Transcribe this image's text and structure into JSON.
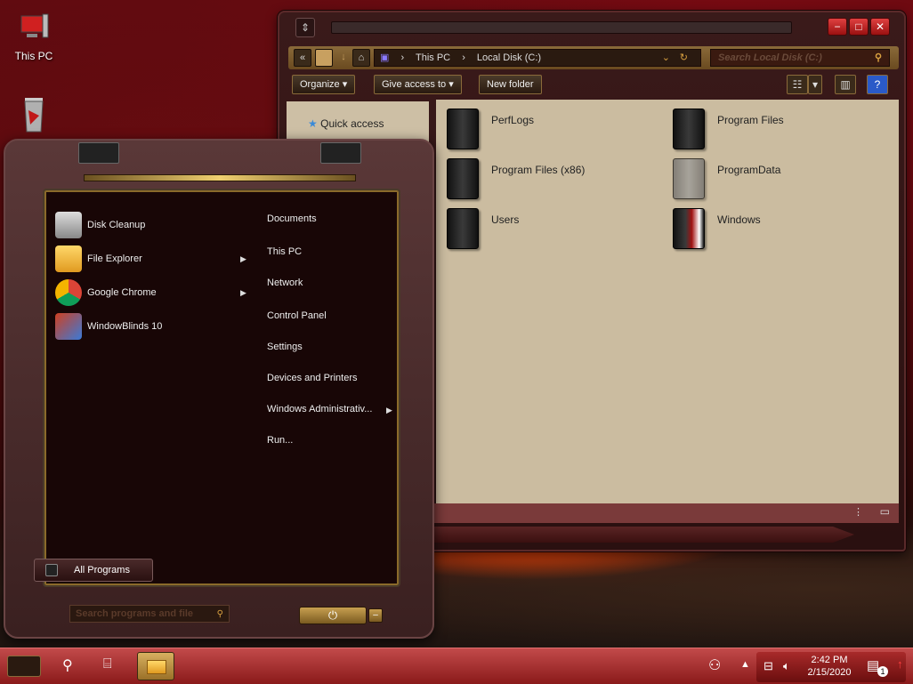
{
  "desktop": {
    "icons": [
      {
        "label": "This PC",
        "icon": "this-pc-icon"
      },
      {
        "label": "",
        "icon": "recycle-bin-icon"
      }
    ]
  },
  "explorer": {
    "title_menu_icon": "window-menu-icon",
    "controls": {
      "minimize": "−",
      "maximize": "□",
      "close": "✕"
    },
    "breadcrumb": [
      "This PC",
      "Local Disk (C:)"
    ],
    "search_placeholder": "Search Local Disk (C:)",
    "toolbar": {
      "organize": "Organize",
      "give_access": "Give access to",
      "new_folder": "New folder"
    },
    "nav_pane": {
      "quick_access": "Quick access"
    },
    "folders": [
      {
        "name": "PerfLogs"
      },
      {
        "name": "Program Files"
      },
      {
        "name": "Program Files (x86)"
      },
      {
        "name": "ProgramData"
      },
      {
        "name": "Users"
      },
      {
        "name": "Windows"
      }
    ]
  },
  "start_menu": {
    "programs": [
      {
        "label": "Disk Cleanup",
        "icon": "disk-cleanup-icon",
        "has_submenu": false
      },
      {
        "label": "File Explorer",
        "icon": "file-explorer-icon",
        "has_submenu": true
      },
      {
        "label": "Google Chrome",
        "icon": "chrome-icon",
        "has_submenu": true
      },
      {
        "label": "WindowBlinds 10",
        "icon": "windowblinds-icon",
        "has_submenu": false
      }
    ],
    "places": [
      "Documents",
      "This PC",
      "Network",
      "Control Panel",
      "Settings",
      "Devices and Printers",
      "Windows Administrativ...",
      "Run..."
    ],
    "all_programs": "All Programs",
    "search_placeholder": "Search programs and file",
    "power_icon": "⏻"
  },
  "taskbar": {
    "time": "2:42 PM",
    "date": "2/15/2020",
    "notification_count": "1"
  },
  "colors": {
    "accent_gold": "#d8b060",
    "taskbar_red": "#a82a2a"
  }
}
